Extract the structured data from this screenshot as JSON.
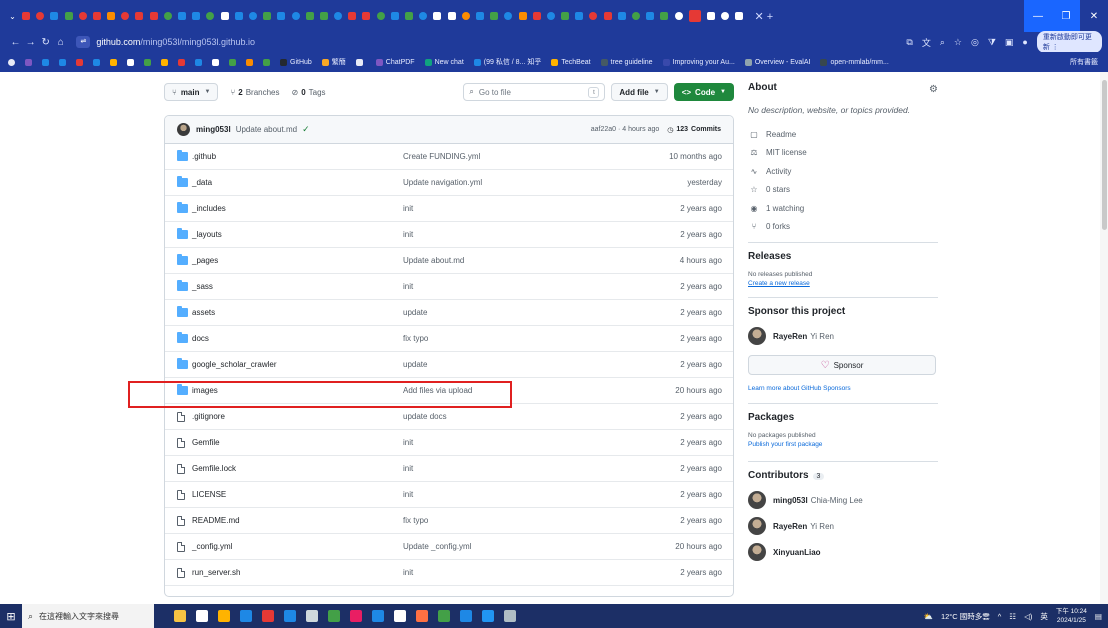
{
  "browser": {
    "url_host": "github.com",
    "url_path": "/ming053l/ming053l.github.io",
    "update_label": "重新啟動即可更新 ⋮",
    "tab_colors": [
      "#e53935",
      "#e53935",
      "#1e88e5",
      "#43a047",
      "#e53935",
      "#e53935",
      "#fb8c00",
      "#e53935",
      "#e53935",
      "#e53935",
      "#43a047",
      "#1e88e5",
      "#1e88e5",
      "#43a047",
      "#fff",
      "#1e88e5",
      "#1e88e5",
      "#43a047",
      "#1e88e5",
      "#1e88e5",
      "#43a047",
      "#43a047",
      "#1e88e5",
      "#e53935",
      "#e53935",
      "#43a047",
      "#1e88e5",
      "#43a047",
      "#1e88e5",
      "#fff",
      "#fff",
      "#fb8c00",
      "#1e88e5",
      "#43a047",
      "#1e88e5",
      "#fb8c00",
      "#e53935",
      "#1e88e5",
      "#43a047",
      "#1e88e5",
      "#e53935",
      "#e53935",
      "#1e88e5",
      "#43a047",
      "#1e88e5",
      "#43a047",
      "#fff",
      "#e53935",
      "#fff",
      "#fff",
      "#fff"
    ]
  },
  "bookmarks": [
    {
      "label": "GitHub",
      "color": "#24292f"
    },
    {
      "label": "繁簡",
      "color": "#f9a825"
    },
    {
      "label": "",
      "color": "#e8eaf6"
    },
    {
      "label": "ChatPDF",
      "color": "#7e57c2"
    },
    {
      "label": "New chat",
      "color": "#10a37f"
    },
    {
      "label": "(99 私信 / 8... 知乎",
      "color": "#1e88e5"
    },
    {
      "label": "TechBeat",
      "color": "#ffb300"
    },
    {
      "label": "tree guideline",
      "color": "#455a64"
    },
    {
      "label": "Improving your Au...",
      "color": "#3949ab"
    },
    {
      "label": "Overview - EvalAI",
      "color": "#90a4ae"
    },
    {
      "label": "open-mmlab/mm...",
      "color": "#37474f"
    }
  ],
  "bookmarks_right": "所有書籤",
  "repo": {
    "branch": "main",
    "branches_count": "2",
    "branches_label": "Branches",
    "tags_count": "0",
    "tags_label": "Tags",
    "goto_placeholder": "Go to file",
    "goto_key": "t",
    "add_file": "Add file",
    "code_label": "Code",
    "latest_commit": {
      "author": "ming053l",
      "message": "Update about.md",
      "hash_time": "aaf22a0 · 4 hours ago",
      "commits_count": "123",
      "commits_label": "Commits"
    },
    "files": [
      {
        "type": "dir",
        "name": ".github",
        "msg": "Create FUNDING.yml",
        "age": "10 months ago"
      },
      {
        "type": "dir",
        "name": "_data",
        "msg": "Update navigation.yml",
        "age": "yesterday"
      },
      {
        "type": "dir",
        "name": "_includes",
        "msg": "init",
        "age": "2 years ago"
      },
      {
        "type": "dir",
        "name": "_layouts",
        "msg": "init",
        "age": "2 years ago"
      },
      {
        "type": "dir",
        "name": "_pages",
        "msg": "Update about.md",
        "age": "4 hours ago"
      },
      {
        "type": "dir",
        "name": "_sass",
        "msg": "init",
        "age": "2 years ago"
      },
      {
        "type": "dir",
        "name": "assets",
        "msg": "update",
        "age": "2 years ago"
      },
      {
        "type": "dir",
        "name": "docs",
        "msg": "fix typo",
        "age": "2 years ago"
      },
      {
        "type": "dir",
        "name": "google_scholar_crawler",
        "msg": "update",
        "age": "2 years ago"
      },
      {
        "type": "dir",
        "name": "images",
        "msg": "Add files via upload",
        "age": "20 hours ago"
      },
      {
        "type": "file",
        "name": ".gitignore",
        "msg": "update docs",
        "age": "2 years ago"
      },
      {
        "type": "file",
        "name": "Gemfile",
        "msg": "init",
        "age": "2 years ago"
      },
      {
        "type": "file",
        "name": "Gemfile.lock",
        "msg": "init",
        "age": "2 years ago"
      },
      {
        "type": "file",
        "name": "LICENSE",
        "msg": "init",
        "age": "2 years ago"
      },
      {
        "type": "file",
        "name": "README.md",
        "msg": "fix typo",
        "age": "2 years ago"
      },
      {
        "type": "file",
        "name": "_config.yml",
        "msg": "Update _config.yml",
        "age": "20 hours ago"
      },
      {
        "type": "file",
        "name": "run_server.sh",
        "msg": "init",
        "age": "2 years ago"
      }
    ]
  },
  "about": {
    "title": "About",
    "description": "No description, website, or topics provided.",
    "items": [
      {
        "icon": "book-icon",
        "glyph": "▢",
        "label": "Readme"
      },
      {
        "icon": "law-icon",
        "glyph": "⚖",
        "label": "MIT license"
      },
      {
        "icon": "pulse-icon",
        "glyph": "∿",
        "label": "Activity"
      },
      {
        "icon": "star-icon",
        "glyph": "☆",
        "label": "0 stars"
      },
      {
        "icon": "eye-icon",
        "glyph": "◉",
        "label": "1 watching"
      },
      {
        "icon": "fork-icon",
        "glyph": "⑂",
        "label": "0 forks"
      }
    ]
  },
  "releases": {
    "title": "Releases",
    "none": "No releases published",
    "create": "Create a new release"
  },
  "sponsor": {
    "title": "Sponsor this project",
    "user": "RayeRen",
    "user_name": "Yi Ren",
    "button": "Sponsor",
    "learn": "Learn more about GitHub Sponsors"
  },
  "packages": {
    "title": "Packages",
    "none": "No packages published",
    "publish": "Publish your first package"
  },
  "contributors": {
    "title": "Contributors",
    "count": "3",
    "people": [
      {
        "login": "ming053l",
        "name": "Chia-Ming Lee"
      },
      {
        "login": "RayeRen",
        "name": "Yi Ren"
      },
      {
        "login": "XinyuanLiao",
        "name": ""
      }
    ]
  },
  "taskbar": {
    "search_placeholder": "在這裡輸入文字來搜尋",
    "weather": "12°C 國時多雲",
    "ime": "英",
    "time": "下午 10:24",
    "date": "2024/1/25",
    "app_colors": [
      "#f6c343",
      "#ffffff",
      "#ffb300",
      "#1e88e5",
      "#e53935",
      "#1e88e5",
      "#cfd8dc",
      "#43a047",
      "#e91e63",
      "#1e88e5",
      "#ffffff",
      "#ff7043",
      "#43a047",
      "#1e88e5",
      "#2196f3",
      "#b0bec5"
    ]
  }
}
